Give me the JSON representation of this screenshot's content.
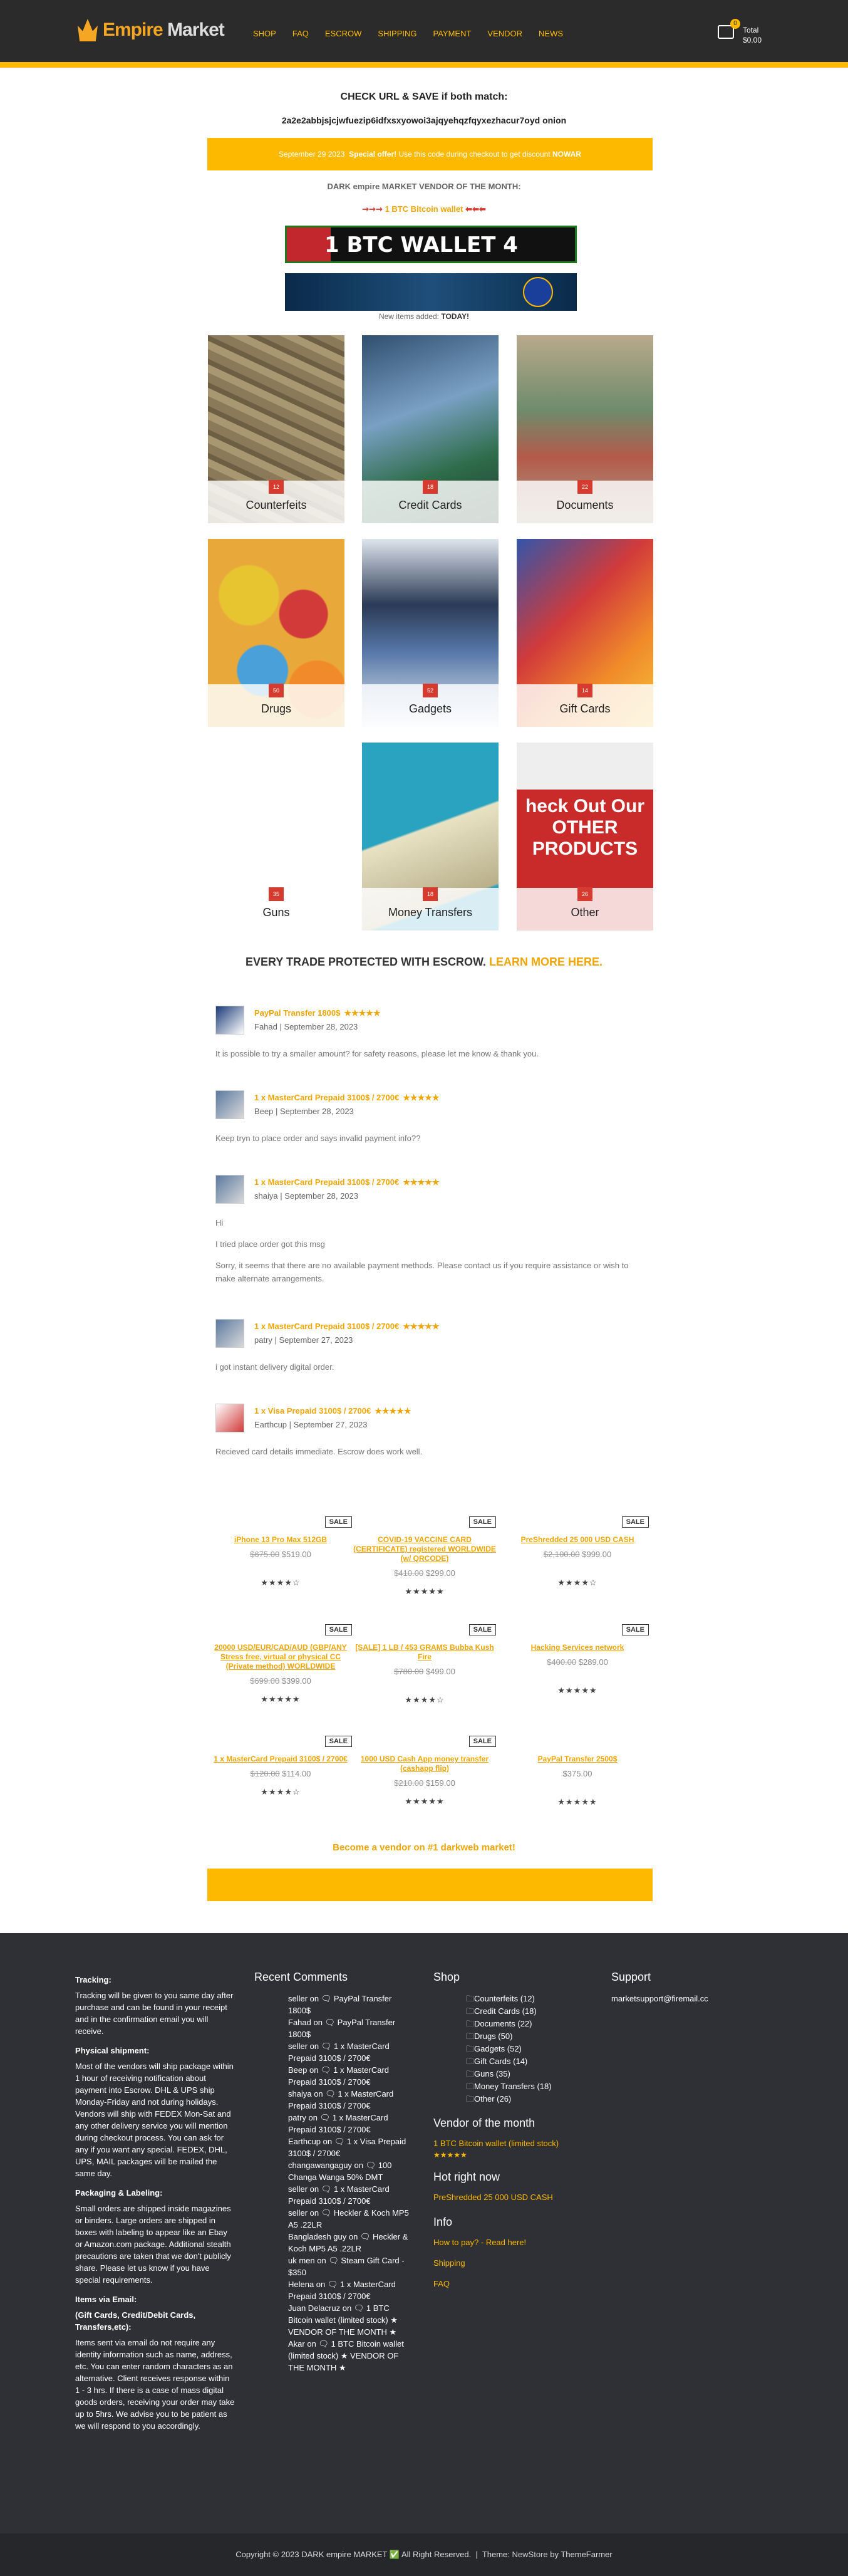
{
  "header": {
    "brand_a": "Empire",
    "brand_b": " Market",
    "nav": [
      "SHOP",
      "FAQ",
      "ESCROW",
      "SHIPPING",
      "PAYMENT",
      "VENDOR",
      "NEWS"
    ],
    "cart_count": "0",
    "cart_total_label": "Total",
    "cart_total": "$0.00"
  },
  "check": {
    "title": "CHECK URL & SAVE if both match:",
    "url": "2a2e2abbjsjcjwfuezip6idfxsxyowoi3ajqyehqzfqyxezhacur7oyd onion"
  },
  "promo": {
    "date": "September 29 2023",
    "label": "Special offer!",
    "text": "Use this code during checkout to get discount",
    "code": "NOWAR"
  },
  "vendor_month": {
    "title": "DARK empire MARKET VENDOR OF THE MONTH:",
    "link": "1 BTC Bitcoin wallet",
    "banner": "1 BTC WALLET 4 SALE",
    "new_items_prefix": "New items added:",
    "new_items_day": "TODAY!"
  },
  "categories": [
    {
      "name": "Counterfeits",
      "count": "12"
    },
    {
      "name": "Credit Cards",
      "count": "18"
    },
    {
      "name": "Documents",
      "count": "22"
    },
    {
      "name": "Drugs",
      "count": "50"
    },
    {
      "name": "Gadgets",
      "count": "52"
    },
    {
      "name": "Gift Cards",
      "count": "14"
    },
    {
      "name": "Guns",
      "count": "35"
    },
    {
      "name": "Money Transfers",
      "count": "18"
    },
    {
      "name": "Other",
      "count": "26"
    }
  ],
  "other_sign": "heck Out Our OTHER PRODUCTS",
  "escrow": {
    "text": "EVERY TRADE PROTECTED WITH ESCROW.",
    "link": "LEARN MORE HERE."
  },
  "reviews": [
    {
      "title": "PayPal Transfer 1800$",
      "author": "Fahad",
      "date": "September 28, 2023",
      "text": [
        "It is possible to try a smaller amount? for safety reasons, please let me know & thank you."
      ]
    },
    {
      "title": "1 x MasterCard Prepaid 3100$ / 2700€",
      "author": "Beep",
      "date": "September 28, 2023",
      "text": [
        "Keep tryn to place order and says invalid payment info??"
      ]
    },
    {
      "title": "1 x MasterCard Prepaid 3100$ / 2700€",
      "author": "shaiya",
      "date": "September 28, 2023",
      "text": [
        "Hi",
        "I tried place order got this msg",
        "Sorry, it seems that there are no available payment methods. Please contact us if you require assistance or wish to make alternate arrangements."
      ]
    },
    {
      "title": "1 x MasterCard Prepaid 3100$ / 2700€",
      "author": "patry",
      "date": "September 27, 2023",
      "text": [
        "i got instant delivery digital order."
      ]
    },
    {
      "title": "1 x Visa Prepaid 3100$ / 2700€",
      "author": "Earthcup",
      "date": "September 27, 2023",
      "text": [
        "Recieved card details immediate. Escrow does work well."
      ]
    }
  ],
  "stars": "★★★★★",
  "products": [
    {
      "sale": "SALE",
      "name": "iPhone 13 Pro Max 512GB",
      "old": "$675.00",
      "price": "$519.00",
      "rating": "★★★★☆"
    },
    {
      "sale": "SALE",
      "name": "COVID-19 VACCINE CARD (CERTIFICATE) registered WORLDWIDE (w/ QRCODE)",
      "old": "$410.00",
      "price": "$299.00",
      "rating": "★★★★★"
    },
    {
      "sale": "SALE",
      "name": "PreShredded 25 000 USD CASH",
      "old": "$2,100.00",
      "price": "$999.00",
      "rating": "★★★★☆"
    },
    {
      "sale": "SALE",
      "name": "20000 USD/EUR/CAD/AUD (GBP/ANY Stress free, virtual or physical CC (Private method) WORLDWIDE",
      "old": "$699.00",
      "price": "$399.00",
      "rating": "★★★★★"
    },
    {
      "sale": "SALE",
      "name": "[SALE] 1 LB / 453 GRAMS Bubba Kush Fire",
      "old": "$780.00",
      "price": "$499.00",
      "rating": "★★★★☆"
    },
    {
      "sale": "SALE",
      "name": "Hacking Services network",
      "old": "$400.00",
      "price": "$289.00",
      "rating": "★★★★★"
    },
    {
      "sale": "SALE",
      "name": "1 x MasterCard Prepaid 3100$ / 2700€",
      "old": "$120.00",
      "price": "$114.00",
      "rating": "★★★★☆"
    },
    {
      "sale": "SALE",
      "name": "1000 USD Cash App money transfer (cashapp flip)",
      "old": "$210.00",
      "price": "$159.00",
      "rating": "★★★★★"
    },
    {
      "sale": "",
      "name": "PayPal Transfer 2500$",
      "old": "",
      "price": "$375.00",
      "rating": "★★★★★"
    }
  ],
  "become_vendor": "Become a vendor on #1 darkweb market!",
  "footer": {
    "tracking_h": "Tracking:",
    "tracking": "Tracking will be given to you same day after purchase and can be found in your receipt and in the confirmation email you will receive.",
    "shipment_h": "Physical shipment:",
    "shipment": "Most of the vendors will ship package within 1 hour of receiving notification about payment into Escrow. DHL & UPS ship Monday-Friday and not during holidays. Vendors will ship with FEDEX Mon-Sat and any other delivery service you will mention during checkout process. You can ask for any if you want any special. FEDEX, DHL, UPS, MAIL packages will be mailed the same day.",
    "packaging_h": "Packaging & Labeling:",
    "packaging": "Small orders are shipped inside magazines or binders. Large orders are shipped in boxes with labeling to appear like an Ebay or Amazon.com package. Additional stealth precautions are taken that we don't publicly share. Please let us know if you have special requirements.",
    "email_h": "Items via Email:",
    "email_sub": "(Gift Cards, Credit/Debit Cards, Transfers,etc):",
    "email": "Items sent via email do not require any identity information such as name, address, etc. You can enter random characters as an alternative. Client receives response within 1 - 3 hrs. If there is a case of mass digital goods orders, receiving your order may take up to 5hrs. We advise you to be patient as we will respond to you accordingly.",
    "recent_h": "Recent Comments",
    "recent": [
      "seller on 🗨 PayPal Transfer 1800$",
      "Fahad on 🗨 PayPal Transfer 1800$",
      "seller on 🗨 1 x MasterCard Prepaid 3100$ / 2700€",
      "Beep on 🗨 1 x MasterCard Prepaid 3100$ / 2700€",
      "shaiya on 🗨 1 x MasterCard Prepaid 3100$ / 2700€",
      "patry on 🗨 1 x MasterCard Prepaid 3100$ / 2700€",
      "Earthcup on 🗨 1 x Visa Prepaid 3100$ / 2700€",
      "changawangaguy on 🗨 100 Changa Wanga 50% DMT",
      "seller on 🗨 1 x MasterCard Prepaid 3100$ / 2700€",
      "seller on 🗨 Heckler & Koch MP5 A5 .22LR",
      "Bangladesh guy on 🗨 Heckler & Koch MP5 A5 .22LR",
      "uk men on 🗨 Steam Gift Card - $350",
      "Helena on 🗨 1 x MasterCard Prepaid 3100$ / 2700€",
      "Juan Delacruz on 🗨 1 BTC Bitcoin wallet (limited stock) ★ VENDOR OF THE MONTH ★",
      "Akar on 🗨 1 BTC Bitcoin wallet (limited stock) ★ VENDOR OF THE MONTH ★"
    ],
    "shop_h": "Shop",
    "shop": [
      "Counterfeits (12)",
      "Credit Cards (18)",
      "Documents (22)",
      "Drugs (50)",
      "Gadgets (52)",
      "Gift Cards (14)",
      "Guns (35)",
      "Money Transfers (18)",
      "Other (26)"
    ],
    "vendor_h": "Vendor of the month",
    "vendor_link": "1 BTC Bitcoin wallet (limited stock)",
    "vendor_stars": "★★★★★",
    "hot_h": "Hot right now",
    "hot_link": "PreShredded 25 000 USD CASH",
    "info_h": "Info",
    "info": [
      "How to pay? - Read here!",
      "Shipping",
      "FAQ"
    ],
    "support_h": "Support",
    "support_email": "marketsupport@firemail.cc",
    "copyright": "Copyright © 2023 DARK empire MARKET ✅ All Right Reserved.",
    "theme_prefix": "Theme:",
    "theme": "NewStore",
    "theme_by": "by ThemeFarmer"
  },
  "colors": {
    "accent": "#fcb900",
    "header_bg": "#2b2b2b",
    "footer_bg": "#2e3035",
    "badge_red": "#d63b2f"
  }
}
